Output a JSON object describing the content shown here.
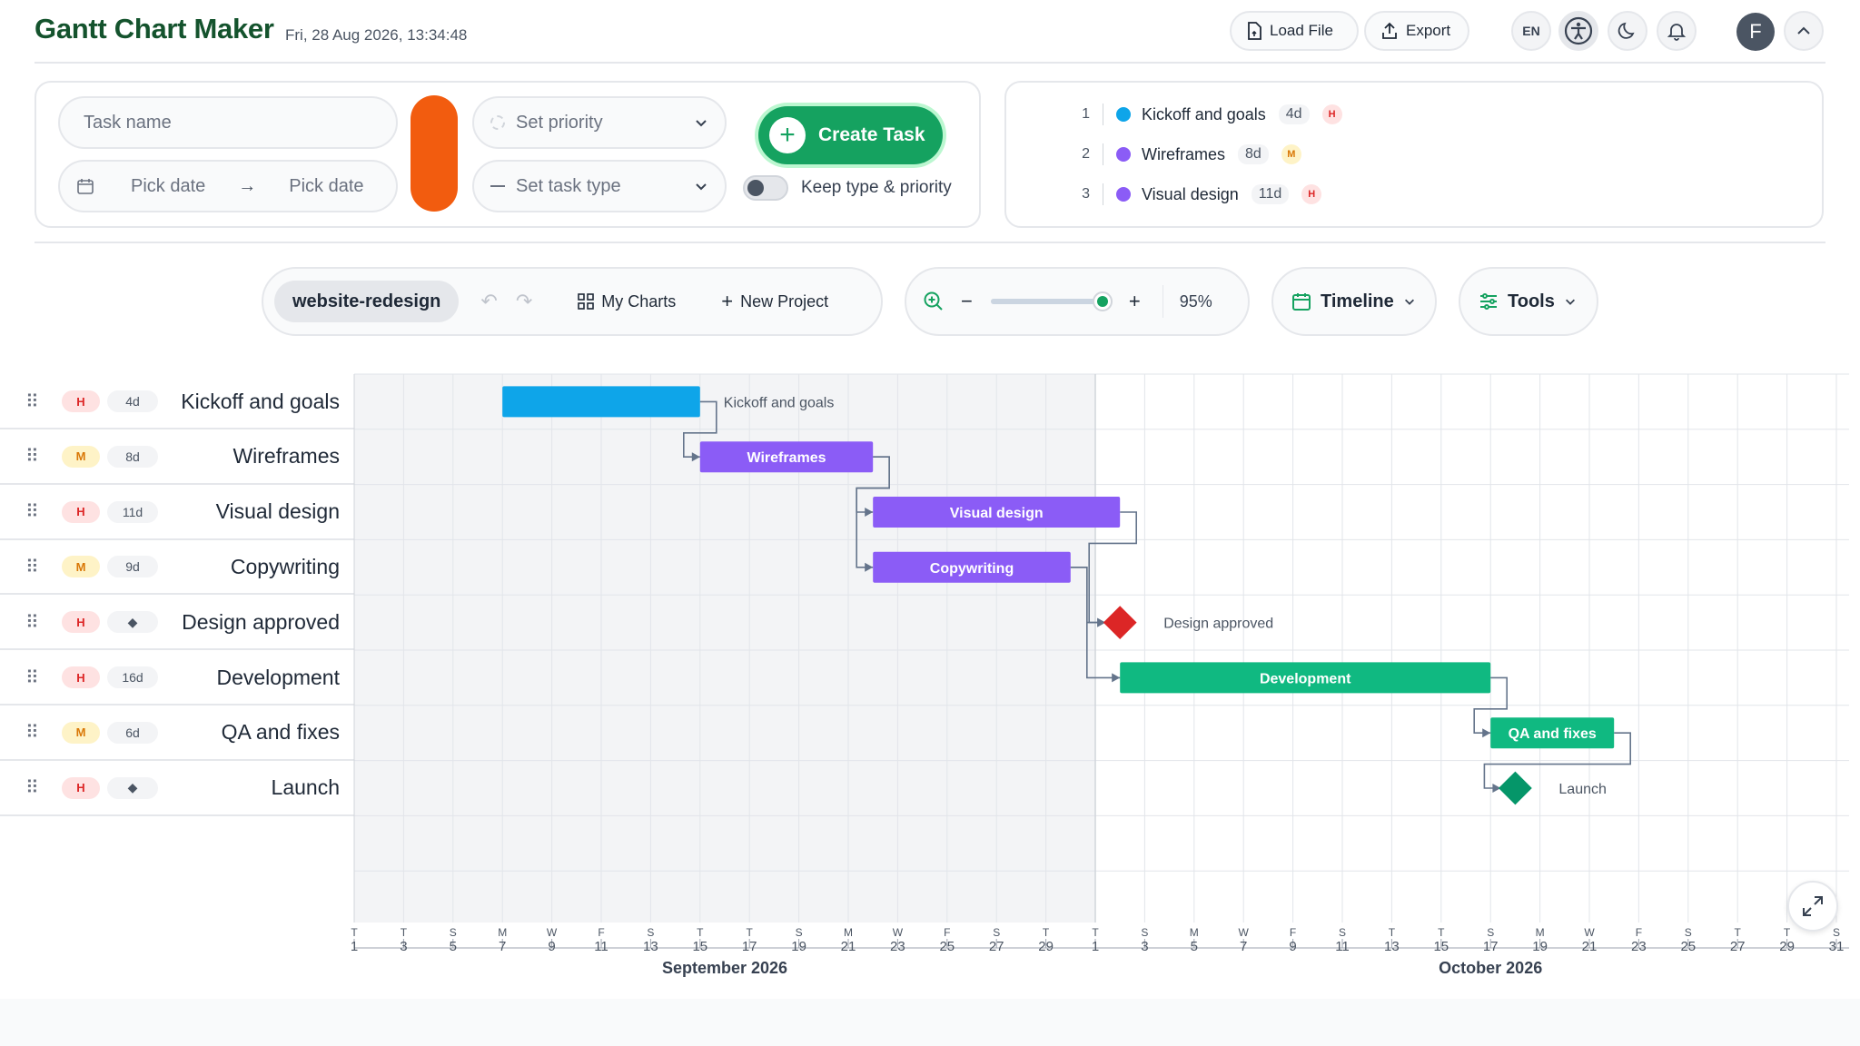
{
  "header": {
    "title": "Gantt Chart Maker",
    "datetime": "Fri, 28 Aug 2026, 13:34:48",
    "load_label": "Load File",
    "export_label": "Export",
    "lang": "EN",
    "avatar": "F"
  },
  "form": {
    "task_placeholder": "Task name",
    "start_placeholder": "Pick date",
    "end_placeholder": "Pick date",
    "priority_placeholder": "Set priority",
    "type_placeholder": "Set task type",
    "create_label": "Create Task",
    "keep_label": "Keep type & priority",
    "color_swatch": "#f25c0f"
  },
  "summary": [
    {
      "num": "1",
      "name": "Kickoff and goals",
      "dur": "4d",
      "prio": "H",
      "color": "#0ea5e9"
    },
    {
      "num": "2",
      "name": "Wireframes",
      "dur": "8d",
      "prio": "M",
      "color": "#8b5cf6"
    },
    {
      "num": "3",
      "name": "Visual design",
      "dur": "11d",
      "prio": "H",
      "color": "#8b5cf6"
    }
  ],
  "toolbar": {
    "project": "website-redesign",
    "my_charts": "My Charts",
    "new_project": "New Project",
    "zoom": "95%",
    "zoom_level": 0.95,
    "timeline": "Timeline",
    "tools": "Tools"
  },
  "tasks": [
    {
      "name": "Kickoff and goals",
      "prio": "H",
      "dur": "4d",
      "start": 3,
      "days": 4,
      "type": "task",
      "color": "#0ea5e9",
      "label": "Kickoff and goals"
    },
    {
      "name": "Wireframes",
      "prio": "M",
      "dur": "8d",
      "start": 7,
      "days": 3.5,
      "type": "task",
      "color": "#8b5cf6",
      "label": "Wireframes"
    },
    {
      "name": "Visual design",
      "prio": "H",
      "dur": "11d",
      "start": 10.5,
      "days": 5,
      "type": "task",
      "color": "#8b5cf6",
      "label": "Visual design"
    },
    {
      "name": "Copywriting",
      "prio": "M",
      "dur": "9d",
      "start": 10.5,
      "days": 4,
      "type": "task",
      "color": "#8b5cf6",
      "label": "Copywriting"
    },
    {
      "name": "Design approved",
      "prio": "H",
      "dur": "◆",
      "start": 15.5,
      "days": 0,
      "type": "milestone",
      "color": "#dc2626",
      "label": "Design approved"
    },
    {
      "name": "Development",
      "prio": "H",
      "dur": "16d",
      "start": 15.5,
      "days": 7.5,
      "type": "task",
      "color": "#10b981",
      "label": "Development"
    },
    {
      "name": "QA and fixes",
      "prio": "M",
      "dur": "6d",
      "start": 23,
      "days": 2.5,
      "type": "task",
      "color": "#10b981",
      "label": "QA and fixes"
    },
    {
      "name": "Launch",
      "prio": "H",
      "dur": "◆",
      "start": 23.5,
      "days": 0,
      "type": "milestone",
      "color": "#059669",
      "label": "Launch"
    }
  ],
  "axis": {
    "ticks": [
      {
        "d": "T",
        "n": "1"
      },
      {
        "d": "T",
        "n": "3"
      },
      {
        "d": "S",
        "n": "5"
      },
      {
        "d": "M",
        "n": "7"
      },
      {
        "d": "W",
        "n": "9"
      },
      {
        "d": "F",
        "n": "11"
      },
      {
        "d": "S",
        "n": "13"
      },
      {
        "d": "T",
        "n": "15"
      },
      {
        "d": "T",
        "n": "17"
      },
      {
        "d": "S",
        "n": "19"
      },
      {
        "d": "M",
        "n": "21"
      },
      {
        "d": "W",
        "n": "23"
      },
      {
        "d": "F",
        "n": "25"
      },
      {
        "d": "S",
        "n": "27"
      },
      {
        "d": "T",
        "n": "29"
      },
      {
        "d": "T",
        "n": "1"
      },
      {
        "d": "S",
        "n": "3"
      },
      {
        "d": "M",
        "n": "5"
      },
      {
        "d": "W",
        "n": "7"
      },
      {
        "d": "F",
        "n": "9"
      },
      {
        "d": "S",
        "n": "11"
      },
      {
        "d": "T",
        "n": "13"
      },
      {
        "d": "T",
        "n": "15"
      },
      {
        "d": "S",
        "n": "17"
      },
      {
        "d": "M",
        "n": "19"
      },
      {
        "d": "W",
        "n": "21"
      },
      {
        "d": "F",
        "n": "23"
      },
      {
        "d": "S",
        "n": "25"
      },
      {
        "d": "T",
        "n": "27"
      },
      {
        "d": "T",
        "n": "29"
      },
      {
        "d": "S",
        "n": "31"
      }
    ],
    "months": [
      {
        "label": "September 2026",
        "tick": 7.5
      },
      {
        "label": "October 2026",
        "tick": 23
      }
    ]
  },
  "links": [
    [
      0,
      1
    ],
    [
      1,
      2
    ],
    [
      1,
      3
    ],
    [
      2,
      4
    ],
    [
      3,
      4
    ],
    [
      3,
      5
    ],
    [
      5,
      6
    ],
    [
      6,
      7
    ]
  ]
}
